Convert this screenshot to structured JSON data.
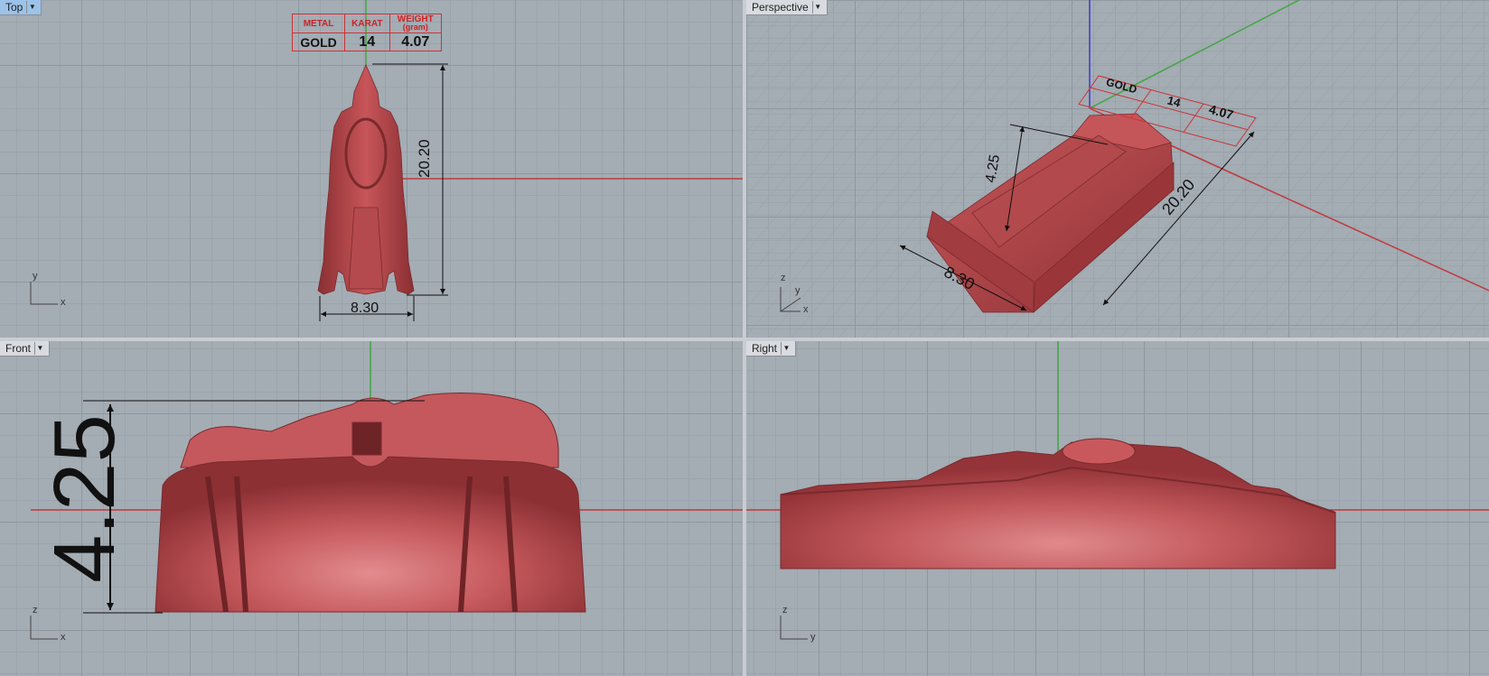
{
  "viewports": {
    "top": {
      "label": "Top",
      "axes": {
        "a": "y",
        "b": "x"
      }
    },
    "perspective": {
      "label": "Perspective",
      "axes": {
        "a": "z",
        "b": "y",
        "c": "x"
      }
    },
    "front": {
      "label": "Front",
      "axes": {
        "a": "z",
        "b": "x"
      }
    },
    "right": {
      "label": "Right",
      "axes": {
        "a": "z",
        "b": "y"
      }
    }
  },
  "spec_table": {
    "headers": [
      "METAL",
      "KARAT",
      "WEIGHT"
    ],
    "weight_unit": "(gram)",
    "values": [
      "GOLD",
      "14",
      "4.07"
    ]
  },
  "dimensions": {
    "height": "20.20",
    "width": "8.30",
    "depth": "4.25"
  },
  "colors": {
    "model": "#b5484b",
    "x_axis": "#c0393b",
    "y_axis": "#3fa83f",
    "z_axis": "#3a3ad0",
    "viewport_bg": "#a4acb4",
    "active_label": "#9cc3ea"
  },
  "icons": {
    "dropdown": "chevron-down-icon"
  }
}
